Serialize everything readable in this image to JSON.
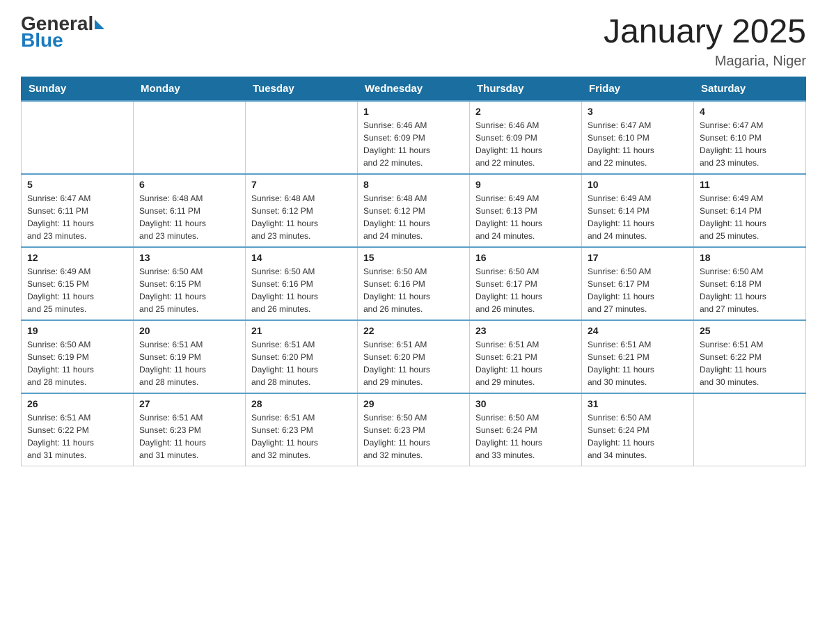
{
  "header": {
    "logo": {
      "line1": "General",
      "arrow": true,
      "line2": "Blue"
    },
    "title": "January 2025",
    "subtitle": "Magaria, Niger"
  },
  "calendar": {
    "headers": [
      "Sunday",
      "Monday",
      "Tuesday",
      "Wednesday",
      "Thursday",
      "Friday",
      "Saturday"
    ],
    "weeks": [
      [
        {
          "day": "",
          "info": ""
        },
        {
          "day": "",
          "info": ""
        },
        {
          "day": "",
          "info": ""
        },
        {
          "day": "1",
          "info": "Sunrise: 6:46 AM\nSunset: 6:09 PM\nDaylight: 11 hours\nand 22 minutes."
        },
        {
          "day": "2",
          "info": "Sunrise: 6:46 AM\nSunset: 6:09 PM\nDaylight: 11 hours\nand 22 minutes."
        },
        {
          "day": "3",
          "info": "Sunrise: 6:47 AM\nSunset: 6:10 PM\nDaylight: 11 hours\nand 22 minutes."
        },
        {
          "day": "4",
          "info": "Sunrise: 6:47 AM\nSunset: 6:10 PM\nDaylight: 11 hours\nand 23 minutes."
        }
      ],
      [
        {
          "day": "5",
          "info": "Sunrise: 6:47 AM\nSunset: 6:11 PM\nDaylight: 11 hours\nand 23 minutes."
        },
        {
          "day": "6",
          "info": "Sunrise: 6:48 AM\nSunset: 6:11 PM\nDaylight: 11 hours\nand 23 minutes."
        },
        {
          "day": "7",
          "info": "Sunrise: 6:48 AM\nSunset: 6:12 PM\nDaylight: 11 hours\nand 23 minutes."
        },
        {
          "day": "8",
          "info": "Sunrise: 6:48 AM\nSunset: 6:12 PM\nDaylight: 11 hours\nand 24 minutes."
        },
        {
          "day": "9",
          "info": "Sunrise: 6:49 AM\nSunset: 6:13 PM\nDaylight: 11 hours\nand 24 minutes."
        },
        {
          "day": "10",
          "info": "Sunrise: 6:49 AM\nSunset: 6:14 PM\nDaylight: 11 hours\nand 24 minutes."
        },
        {
          "day": "11",
          "info": "Sunrise: 6:49 AM\nSunset: 6:14 PM\nDaylight: 11 hours\nand 25 minutes."
        }
      ],
      [
        {
          "day": "12",
          "info": "Sunrise: 6:49 AM\nSunset: 6:15 PM\nDaylight: 11 hours\nand 25 minutes."
        },
        {
          "day": "13",
          "info": "Sunrise: 6:50 AM\nSunset: 6:15 PM\nDaylight: 11 hours\nand 25 minutes."
        },
        {
          "day": "14",
          "info": "Sunrise: 6:50 AM\nSunset: 6:16 PM\nDaylight: 11 hours\nand 26 minutes."
        },
        {
          "day": "15",
          "info": "Sunrise: 6:50 AM\nSunset: 6:16 PM\nDaylight: 11 hours\nand 26 minutes."
        },
        {
          "day": "16",
          "info": "Sunrise: 6:50 AM\nSunset: 6:17 PM\nDaylight: 11 hours\nand 26 minutes."
        },
        {
          "day": "17",
          "info": "Sunrise: 6:50 AM\nSunset: 6:17 PM\nDaylight: 11 hours\nand 27 minutes."
        },
        {
          "day": "18",
          "info": "Sunrise: 6:50 AM\nSunset: 6:18 PM\nDaylight: 11 hours\nand 27 minutes."
        }
      ],
      [
        {
          "day": "19",
          "info": "Sunrise: 6:50 AM\nSunset: 6:19 PM\nDaylight: 11 hours\nand 28 minutes."
        },
        {
          "day": "20",
          "info": "Sunrise: 6:51 AM\nSunset: 6:19 PM\nDaylight: 11 hours\nand 28 minutes."
        },
        {
          "day": "21",
          "info": "Sunrise: 6:51 AM\nSunset: 6:20 PM\nDaylight: 11 hours\nand 28 minutes."
        },
        {
          "day": "22",
          "info": "Sunrise: 6:51 AM\nSunset: 6:20 PM\nDaylight: 11 hours\nand 29 minutes."
        },
        {
          "day": "23",
          "info": "Sunrise: 6:51 AM\nSunset: 6:21 PM\nDaylight: 11 hours\nand 29 minutes."
        },
        {
          "day": "24",
          "info": "Sunrise: 6:51 AM\nSunset: 6:21 PM\nDaylight: 11 hours\nand 30 minutes."
        },
        {
          "day": "25",
          "info": "Sunrise: 6:51 AM\nSunset: 6:22 PM\nDaylight: 11 hours\nand 30 minutes."
        }
      ],
      [
        {
          "day": "26",
          "info": "Sunrise: 6:51 AM\nSunset: 6:22 PM\nDaylight: 11 hours\nand 31 minutes."
        },
        {
          "day": "27",
          "info": "Sunrise: 6:51 AM\nSunset: 6:23 PM\nDaylight: 11 hours\nand 31 minutes."
        },
        {
          "day": "28",
          "info": "Sunrise: 6:51 AM\nSunset: 6:23 PM\nDaylight: 11 hours\nand 32 minutes."
        },
        {
          "day": "29",
          "info": "Sunrise: 6:50 AM\nSunset: 6:23 PM\nDaylight: 11 hours\nand 32 minutes."
        },
        {
          "day": "30",
          "info": "Sunrise: 6:50 AM\nSunset: 6:24 PM\nDaylight: 11 hours\nand 33 minutes."
        },
        {
          "day": "31",
          "info": "Sunrise: 6:50 AM\nSunset: 6:24 PM\nDaylight: 11 hours\nand 34 minutes."
        },
        {
          "day": "",
          "info": ""
        }
      ]
    ]
  }
}
